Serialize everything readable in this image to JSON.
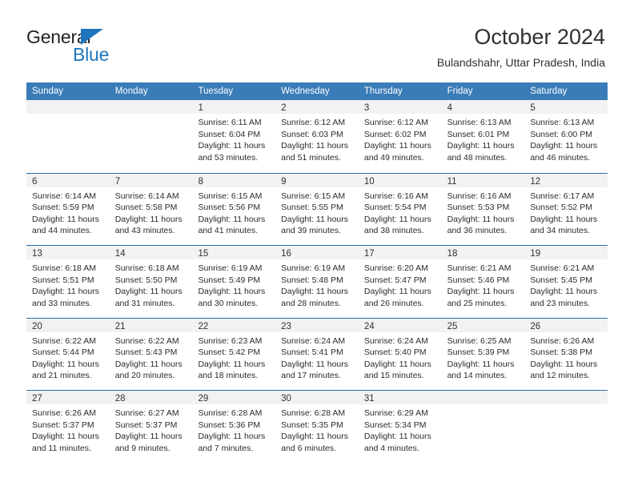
{
  "logo": {
    "word_top": "General",
    "word_bottom": "Blue",
    "triangle_color": "#1e75bb",
    "text_color": "#231f20"
  },
  "header": {
    "title": "October 2024",
    "subtitle": "Bulandshahr, Uttar Pradesh, India"
  },
  "colors": {
    "header_blue": "#3a7cb8",
    "row_border": "#2e6da4",
    "day_band_gray": "#f2f2f2"
  },
  "weekday_headers": [
    "Sunday",
    "Monday",
    "Tuesday",
    "Wednesday",
    "Thursday",
    "Friday",
    "Saturday"
  ],
  "weeks": [
    [
      {
        "day": "",
        "sunrise": "",
        "sunset": "",
        "daylight1": "",
        "daylight2": ""
      },
      {
        "day": "",
        "sunrise": "",
        "sunset": "",
        "daylight1": "",
        "daylight2": ""
      },
      {
        "day": "1",
        "sunrise": "Sunrise: 6:11 AM",
        "sunset": "Sunset: 6:04 PM",
        "daylight1": "Daylight: 11 hours",
        "daylight2": "and 53 minutes."
      },
      {
        "day": "2",
        "sunrise": "Sunrise: 6:12 AM",
        "sunset": "Sunset: 6:03 PM",
        "daylight1": "Daylight: 11 hours",
        "daylight2": "and 51 minutes."
      },
      {
        "day": "3",
        "sunrise": "Sunrise: 6:12 AM",
        "sunset": "Sunset: 6:02 PM",
        "daylight1": "Daylight: 11 hours",
        "daylight2": "and 49 minutes."
      },
      {
        "day": "4",
        "sunrise": "Sunrise: 6:13 AM",
        "sunset": "Sunset: 6:01 PM",
        "daylight1": "Daylight: 11 hours",
        "daylight2": "and 48 minutes."
      },
      {
        "day": "5",
        "sunrise": "Sunrise: 6:13 AM",
        "sunset": "Sunset: 6:00 PM",
        "daylight1": "Daylight: 11 hours",
        "daylight2": "and 46 minutes."
      }
    ],
    [
      {
        "day": "6",
        "sunrise": "Sunrise: 6:14 AM",
        "sunset": "Sunset: 5:59 PM",
        "daylight1": "Daylight: 11 hours",
        "daylight2": "and 44 minutes."
      },
      {
        "day": "7",
        "sunrise": "Sunrise: 6:14 AM",
        "sunset": "Sunset: 5:58 PM",
        "daylight1": "Daylight: 11 hours",
        "daylight2": "and 43 minutes."
      },
      {
        "day": "8",
        "sunrise": "Sunrise: 6:15 AM",
        "sunset": "Sunset: 5:56 PM",
        "daylight1": "Daylight: 11 hours",
        "daylight2": "and 41 minutes."
      },
      {
        "day": "9",
        "sunrise": "Sunrise: 6:15 AM",
        "sunset": "Sunset: 5:55 PM",
        "daylight1": "Daylight: 11 hours",
        "daylight2": "and 39 minutes."
      },
      {
        "day": "10",
        "sunrise": "Sunrise: 6:16 AM",
        "sunset": "Sunset: 5:54 PM",
        "daylight1": "Daylight: 11 hours",
        "daylight2": "and 38 minutes."
      },
      {
        "day": "11",
        "sunrise": "Sunrise: 6:16 AM",
        "sunset": "Sunset: 5:53 PM",
        "daylight1": "Daylight: 11 hours",
        "daylight2": "and 36 minutes."
      },
      {
        "day": "12",
        "sunrise": "Sunrise: 6:17 AM",
        "sunset": "Sunset: 5:52 PM",
        "daylight1": "Daylight: 11 hours",
        "daylight2": "and 34 minutes."
      }
    ],
    [
      {
        "day": "13",
        "sunrise": "Sunrise: 6:18 AM",
        "sunset": "Sunset: 5:51 PM",
        "daylight1": "Daylight: 11 hours",
        "daylight2": "and 33 minutes."
      },
      {
        "day": "14",
        "sunrise": "Sunrise: 6:18 AM",
        "sunset": "Sunset: 5:50 PM",
        "daylight1": "Daylight: 11 hours",
        "daylight2": "and 31 minutes."
      },
      {
        "day": "15",
        "sunrise": "Sunrise: 6:19 AM",
        "sunset": "Sunset: 5:49 PM",
        "daylight1": "Daylight: 11 hours",
        "daylight2": "and 30 minutes."
      },
      {
        "day": "16",
        "sunrise": "Sunrise: 6:19 AM",
        "sunset": "Sunset: 5:48 PM",
        "daylight1": "Daylight: 11 hours",
        "daylight2": "and 28 minutes."
      },
      {
        "day": "17",
        "sunrise": "Sunrise: 6:20 AM",
        "sunset": "Sunset: 5:47 PM",
        "daylight1": "Daylight: 11 hours",
        "daylight2": "and 26 minutes."
      },
      {
        "day": "18",
        "sunrise": "Sunrise: 6:21 AM",
        "sunset": "Sunset: 5:46 PM",
        "daylight1": "Daylight: 11 hours",
        "daylight2": "and 25 minutes."
      },
      {
        "day": "19",
        "sunrise": "Sunrise: 6:21 AM",
        "sunset": "Sunset: 5:45 PM",
        "daylight1": "Daylight: 11 hours",
        "daylight2": "and 23 minutes."
      }
    ],
    [
      {
        "day": "20",
        "sunrise": "Sunrise: 6:22 AM",
        "sunset": "Sunset: 5:44 PM",
        "daylight1": "Daylight: 11 hours",
        "daylight2": "and 21 minutes."
      },
      {
        "day": "21",
        "sunrise": "Sunrise: 6:22 AM",
        "sunset": "Sunset: 5:43 PM",
        "daylight1": "Daylight: 11 hours",
        "daylight2": "and 20 minutes."
      },
      {
        "day": "22",
        "sunrise": "Sunrise: 6:23 AM",
        "sunset": "Sunset: 5:42 PM",
        "daylight1": "Daylight: 11 hours",
        "daylight2": "and 18 minutes."
      },
      {
        "day": "23",
        "sunrise": "Sunrise: 6:24 AM",
        "sunset": "Sunset: 5:41 PM",
        "daylight1": "Daylight: 11 hours",
        "daylight2": "and 17 minutes."
      },
      {
        "day": "24",
        "sunrise": "Sunrise: 6:24 AM",
        "sunset": "Sunset: 5:40 PM",
        "daylight1": "Daylight: 11 hours",
        "daylight2": "and 15 minutes."
      },
      {
        "day": "25",
        "sunrise": "Sunrise: 6:25 AM",
        "sunset": "Sunset: 5:39 PM",
        "daylight1": "Daylight: 11 hours",
        "daylight2": "and 14 minutes."
      },
      {
        "day": "26",
        "sunrise": "Sunrise: 6:26 AM",
        "sunset": "Sunset: 5:38 PM",
        "daylight1": "Daylight: 11 hours",
        "daylight2": "and 12 minutes."
      }
    ],
    [
      {
        "day": "27",
        "sunrise": "Sunrise: 6:26 AM",
        "sunset": "Sunset: 5:37 PM",
        "daylight1": "Daylight: 11 hours",
        "daylight2": "and 11 minutes."
      },
      {
        "day": "28",
        "sunrise": "Sunrise: 6:27 AM",
        "sunset": "Sunset: 5:37 PM",
        "daylight1": "Daylight: 11 hours",
        "daylight2": "and 9 minutes."
      },
      {
        "day": "29",
        "sunrise": "Sunrise: 6:28 AM",
        "sunset": "Sunset: 5:36 PM",
        "daylight1": "Daylight: 11 hours",
        "daylight2": "and 7 minutes."
      },
      {
        "day": "30",
        "sunrise": "Sunrise: 6:28 AM",
        "sunset": "Sunset: 5:35 PM",
        "daylight1": "Daylight: 11 hours",
        "daylight2": "and 6 minutes."
      },
      {
        "day": "31",
        "sunrise": "Sunrise: 6:29 AM",
        "sunset": "Sunset: 5:34 PM",
        "daylight1": "Daylight: 11 hours",
        "daylight2": "and 4 minutes."
      },
      {
        "day": "",
        "sunrise": "",
        "sunset": "",
        "daylight1": "",
        "daylight2": ""
      },
      {
        "day": "",
        "sunrise": "",
        "sunset": "",
        "daylight1": "",
        "daylight2": ""
      }
    ]
  ]
}
